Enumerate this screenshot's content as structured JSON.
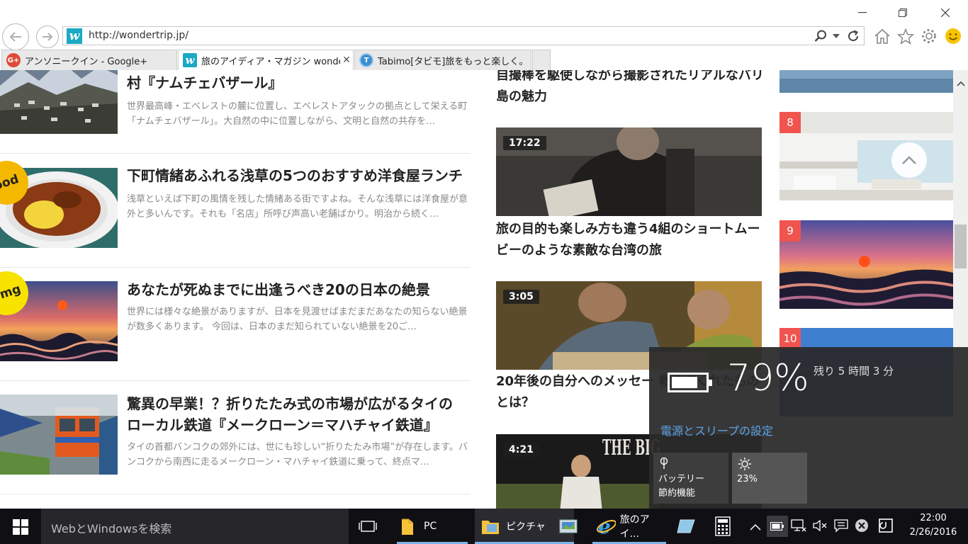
{
  "browser": {
    "url": "http://wondertrip.jp/",
    "favicon_letter": "w",
    "tabs": [
      {
        "label": "アンソニークイン - Google+",
        "icon_letter": "G+",
        "active": false
      },
      {
        "label": "旅のアイディア・マガジン wonde...",
        "icon_letter": "w",
        "active": true
      },
      {
        "label": "Tabimo[タビモ]旅をもっと楽しく。",
        "icon_letter": "T",
        "active": false
      }
    ],
    "icons": [
      "back-icon",
      "forward-icon",
      "search-icon",
      "dropdown-icon",
      "refresh-icon",
      "home-icon",
      "favorites-star-icon",
      "settings-gear-icon",
      "feedback-smiley-icon"
    ]
  },
  "articles": [
    {
      "title": "村『ナムチェバザール』",
      "desc": "世界最高峰・エベレストの麓に位置し、エベレストアタックの拠点として栄える町「ナムチェバザール」。大自然の中に位置しながら、文明と自然の共存を…",
      "badge": ""
    },
    {
      "title": "下町情緒あふれる浅草の5つのおすすめ洋食屋ランチ",
      "desc": "浅草といえば下町の風情を残した情緒ある街ですよね。そんな浅草には洋食屋が意外と多いんです。それも「名店」所呼び声高い老舗ばかり。明治から続く…",
      "badge": "ood"
    },
    {
      "title": "あなたが死ぬまでに出逢うべき20の日本の絶景",
      "desc": "世界には様々な絶景がありますが、日本を見渡せばまだまだあなたの知らない絶景が数多くあります。 今回は、日本のまだ知られていない絶景を20ご…",
      "badge": "omg"
    },
    {
      "title": "驚異の早業！？折りたたみ式の市場が広がるタイのローカル鉄道『メークローン＝マハチャイ鉄道』",
      "desc": "タイの首都バンコクの郊外には、世にも珍しい“折りたたみ市場”が存在します。バンコクから南西に走るメークローン・マハチャイ鉄道に乗って、終点マ…",
      "badge": ""
    }
  ],
  "videos": [
    {
      "title": "自撮棒を駆使しながら撮影されたリアルなバリ島の魅力",
      "duration": ""
    },
    {
      "title": "旅の目的も楽しみ方も違う4組のショートムービーのような素敵な台湾の旅",
      "duration": "17:22"
    },
    {
      "title": "20年後の自分へのメッセー 教えてくれたものとは？",
      "duration": "3:05"
    },
    {
      "title": "",
      "duration": "4:21"
    }
  ],
  "video4_overlay_text": "THE BIG",
  "ranking": [
    {
      "num": ""
    },
    {
      "num": "8"
    },
    {
      "num": "9"
    },
    {
      "num": "10"
    }
  ],
  "battery": {
    "percent": "79%",
    "percent_value": 79,
    "remaining": "残り 5 時間 3 分",
    "settings_link": "電源とスリープの設定",
    "saver_label_1": "バッテリー",
    "saver_label_2": "節約機能",
    "brightness": "23%"
  },
  "taskbar": {
    "search_placeholder": "WebとWindowsを検索",
    "pc": "PC",
    "pictures": "ピクチャ",
    "ie": "旅のアイ...",
    "time": "22:00",
    "date": "2/26/2016"
  },
  "colors": {
    "rank_badge": "#f0544f",
    "link_blue": "#5ba3e6",
    "badge_yellow": "#f5c400",
    "taskbar": "#101014"
  }
}
